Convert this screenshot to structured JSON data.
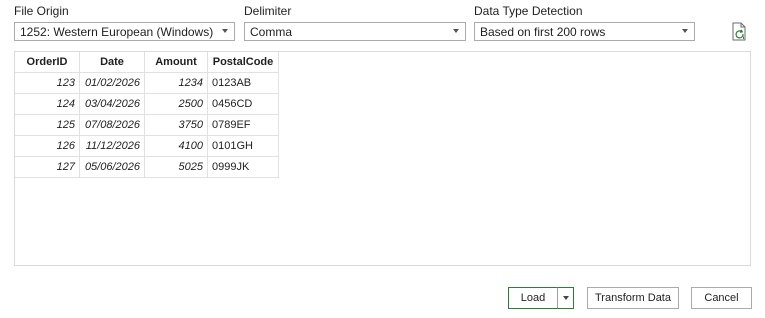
{
  "file_origin": {
    "label": "File Origin",
    "value": "1252: Western European (Windows)"
  },
  "delimiter": {
    "label": "Delimiter",
    "value": "Comma"
  },
  "data_type_detection": {
    "label": "Data Type Detection",
    "value": "Based on first 200 rows"
  },
  "refresh_icon": "refresh-document-icon",
  "table": {
    "headers": [
      "OrderID",
      "Date",
      "Amount",
      "PostalCode"
    ],
    "rows": [
      [
        "123",
        "01/02/2026",
        "1234",
        "0123AB"
      ],
      [
        "124",
        "03/04/2026",
        "2500",
        "0456CD"
      ],
      [
        "125",
        "07/08/2026",
        "3750",
        "0789EF"
      ],
      [
        "126",
        "11/12/2026",
        "4100",
        "0101GH"
      ],
      [
        "127",
        "05/06/2026",
        "5025",
        "0999JK"
      ]
    ]
  },
  "buttons": {
    "load": "Load",
    "transform": "Transform Data",
    "cancel": "Cancel"
  },
  "colors": {
    "load_border": "#2e7d32",
    "control_border": "#ababab"
  }
}
